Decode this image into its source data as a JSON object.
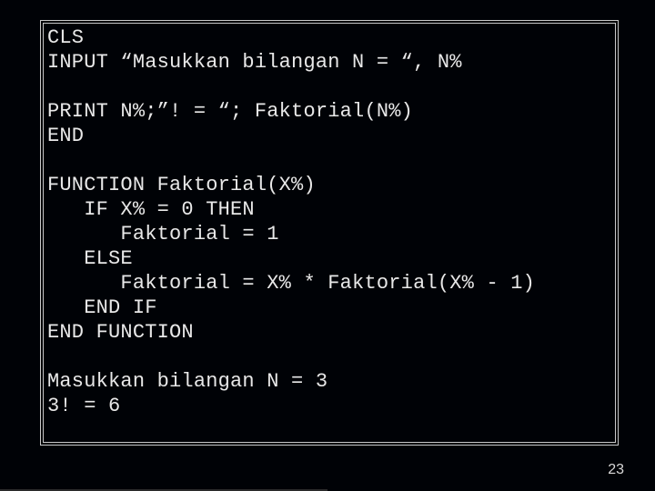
{
  "code": {
    "lines": [
      "CLS",
      "INPUT “Masukkan bilangan N = “, N%",
      "",
      "PRINT N%;”! = “; Faktorial(N%)",
      "END",
      "",
      "FUNCTION Faktorial(X%)",
      "   IF X% = 0 THEN",
      "      Faktorial = 1",
      "   ELSE",
      "      Faktorial = X% * Faktorial(X% - 1)",
      "   END IF",
      "END FUNCTION",
      "",
      "Masukkan bilangan N = 3",
      "3! = 6"
    ]
  },
  "page_number": "23"
}
